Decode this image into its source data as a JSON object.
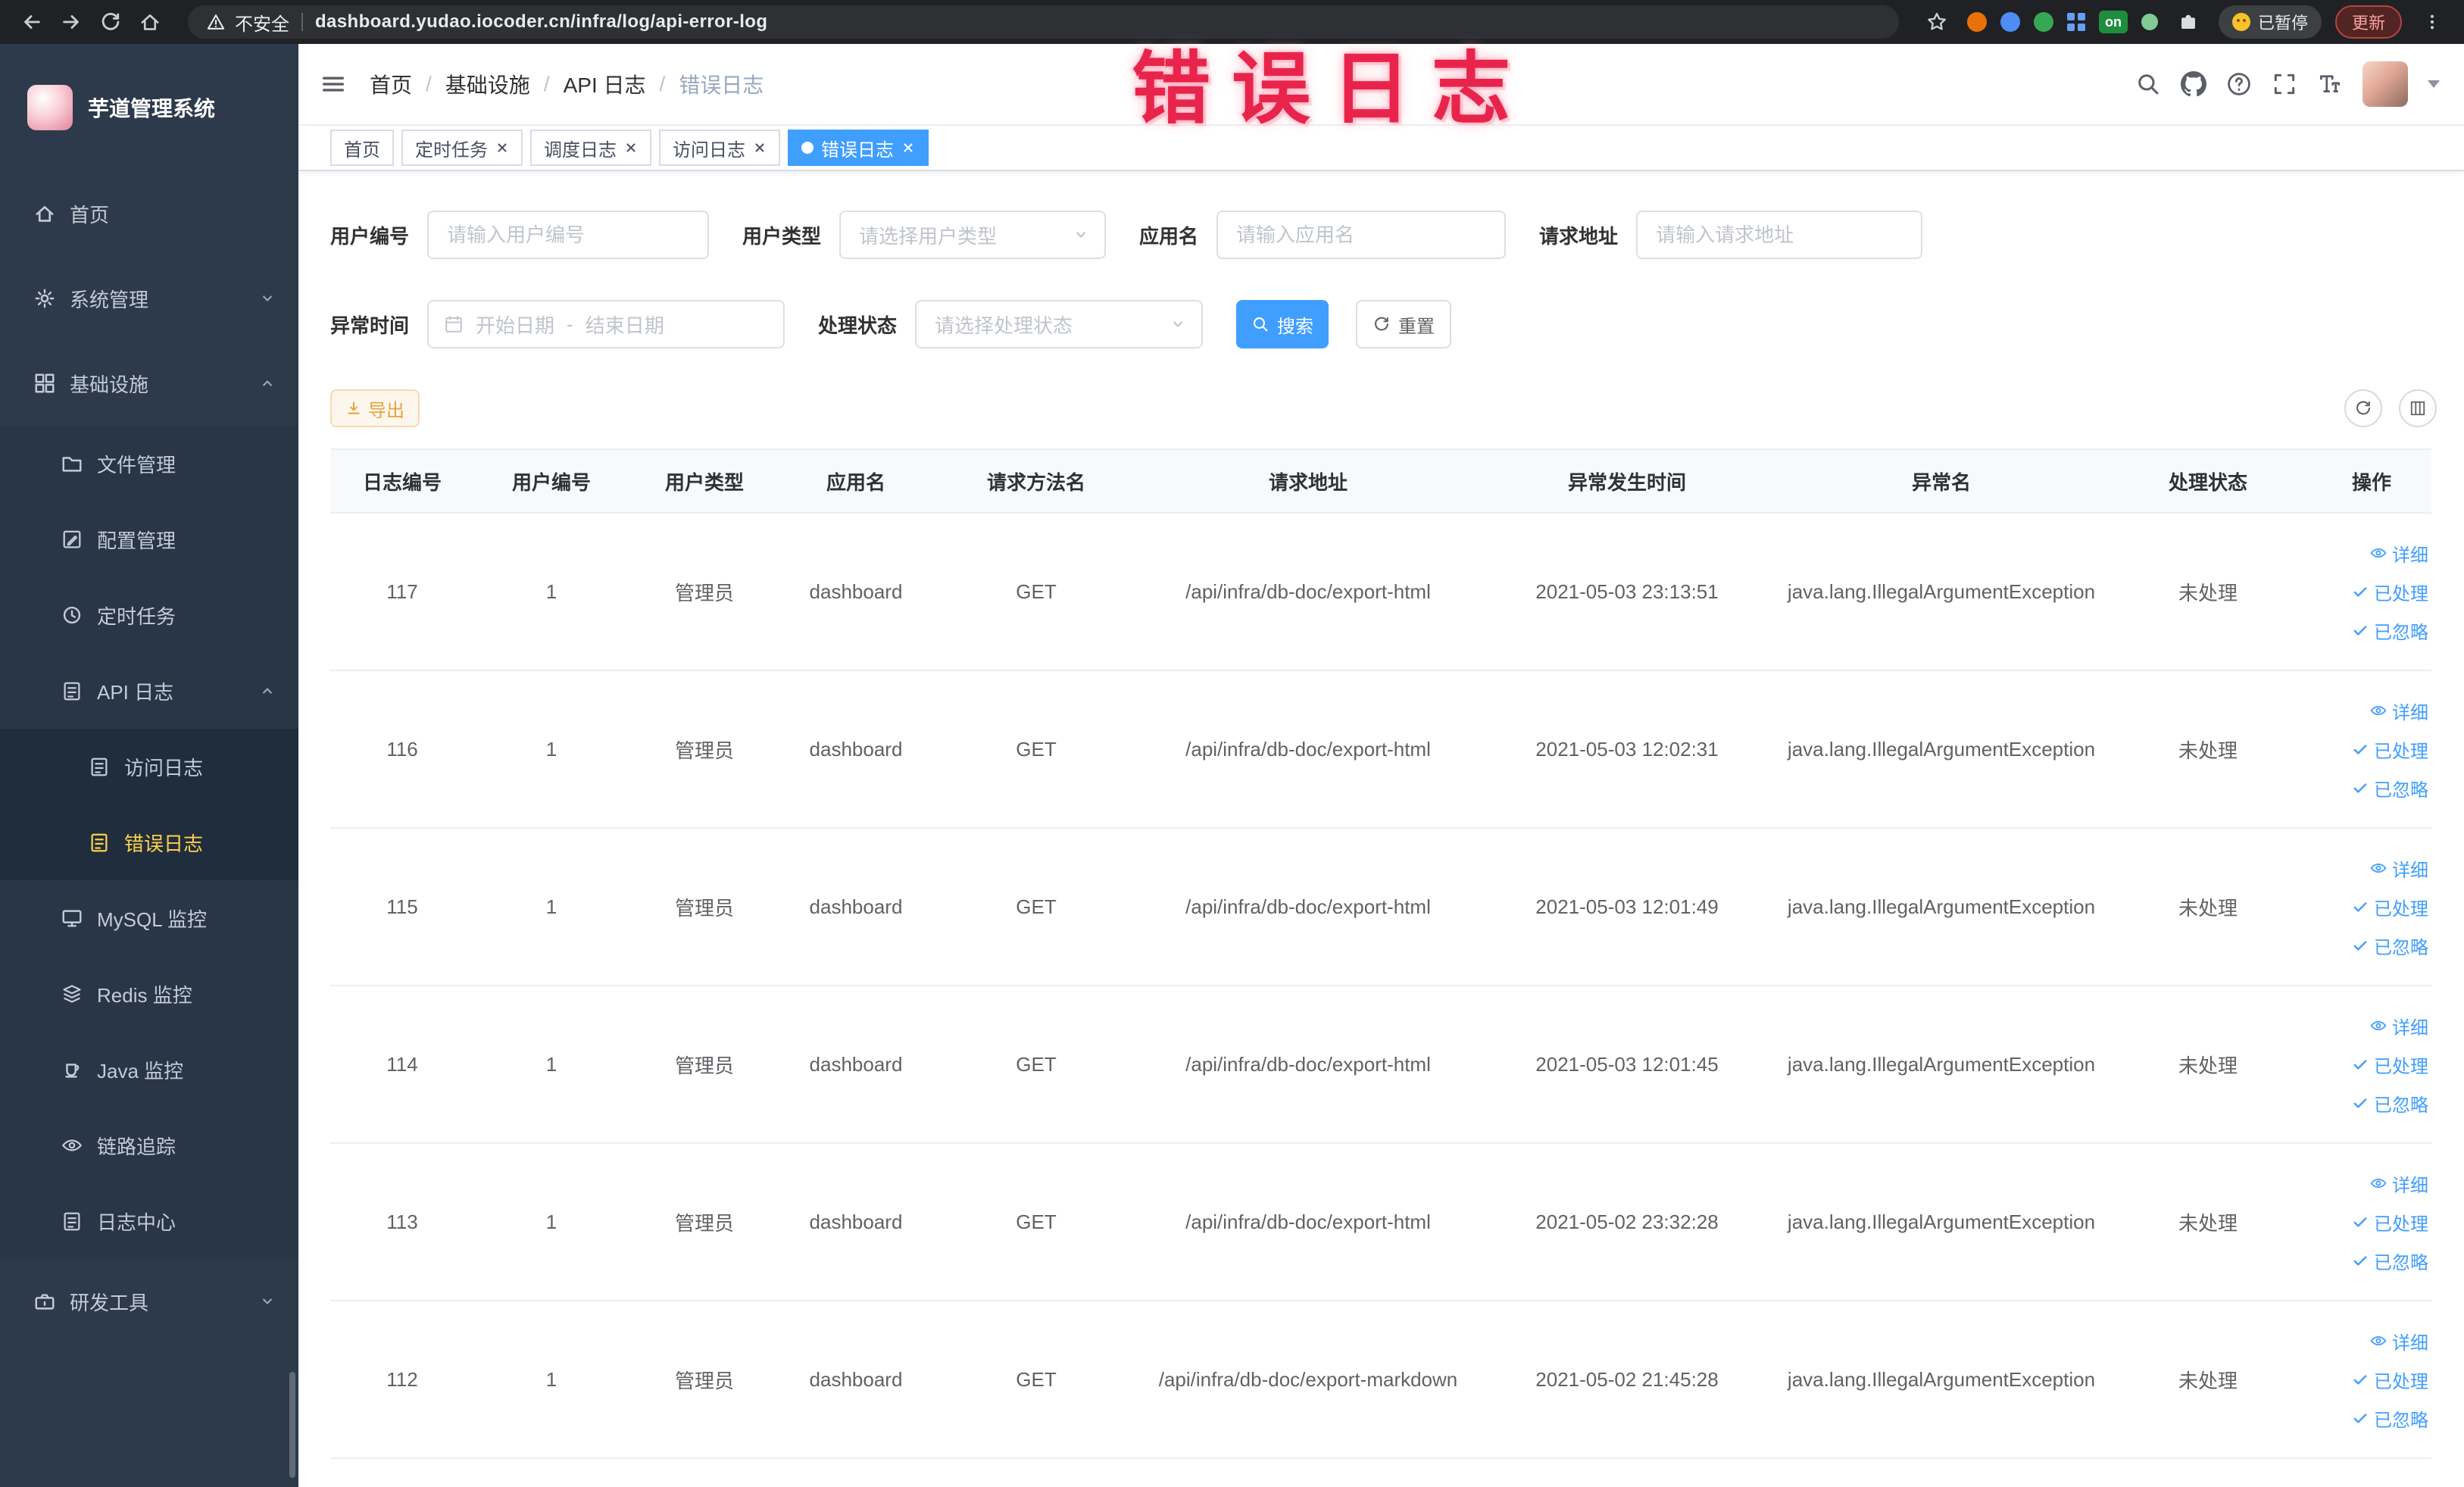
{
  "browser": {
    "security_label": "不安全",
    "url": "dashboard.yudao.iocoder.cn/infra/log/api-error-log",
    "extension_on_badge": "on",
    "paused_badge": "已暂停",
    "update_label": "更新"
  },
  "annotation": {
    "watermark": "错误日志"
  },
  "sidebar": {
    "logo_title": "芋道管理系统",
    "items": [
      {
        "label": "首页"
      },
      {
        "label": "系统管理"
      },
      {
        "label": "基础设施"
      },
      {
        "label": "文件管理"
      },
      {
        "label": "配置管理"
      },
      {
        "label": "定时任务"
      },
      {
        "label": "API 日志"
      },
      {
        "label": "访问日志"
      },
      {
        "label": "错误日志"
      },
      {
        "label": "MySQL 监控"
      },
      {
        "label": "Redis 监控"
      },
      {
        "label": "Java 监控"
      },
      {
        "label": "链路追踪"
      },
      {
        "label": "日志中心"
      },
      {
        "label": "研发工具"
      }
    ]
  },
  "header": {
    "breadcrumb": [
      "首页",
      "基础设施",
      "API 日志",
      "错误日志"
    ],
    "separator": "/"
  },
  "tabs": [
    {
      "label": "首页"
    },
    {
      "label": "定时任务"
    },
    {
      "label": "调度日志"
    },
    {
      "label": "访问日志"
    },
    {
      "label": "错误日志"
    }
  ],
  "filters": {
    "user_id_label": "用户编号",
    "user_id_placeholder": "请输入用户编号",
    "user_type_label": "用户类型",
    "user_type_placeholder": "请选择用户类型",
    "app_name_label": "应用名",
    "app_name_placeholder": "请输入应用名",
    "request_url_label": "请求地址",
    "request_url_placeholder": "请输入请求地址",
    "exception_time_label": "异常时间",
    "start_date_placeholder": "开始日期",
    "range_separator": "-",
    "end_date_placeholder": "结束日期",
    "process_status_label": "处理状态",
    "process_status_placeholder": "请选择处理状态",
    "search_button": "搜索",
    "reset_button": "重置"
  },
  "toolbar": {
    "export_button": "导出"
  },
  "table": {
    "columns": [
      "日志编号",
      "用户编号",
      "用户类型",
      "应用名",
      "请求方法名",
      "请求地址",
      "异常发生时间",
      "异常名",
      "处理状态",
      "操作"
    ],
    "actions": {
      "detail": "详细",
      "processed": "已处理",
      "ignored": "已忽略"
    },
    "rows": [
      {
        "log_id": "117",
        "user_id": "1",
        "user_type": "管理员",
        "app_name": "dashboard",
        "method": "GET",
        "url": "/api/infra/db-doc/export-html",
        "time": "2021-05-03 23:13:51",
        "exception": "java.lang.IllegalArgumentException",
        "status": "未处理"
      },
      {
        "log_id": "116",
        "user_id": "1",
        "user_type": "管理员",
        "app_name": "dashboard",
        "method": "GET",
        "url": "/api/infra/db-doc/export-html",
        "time": "2021-05-03 12:02:31",
        "exception": "java.lang.IllegalArgumentException",
        "status": "未处理"
      },
      {
        "log_id": "115",
        "user_id": "1",
        "user_type": "管理员",
        "app_name": "dashboard",
        "method": "GET",
        "url": "/api/infra/db-doc/export-html",
        "time": "2021-05-03 12:01:49",
        "exception": "java.lang.IllegalArgumentException",
        "status": "未处理"
      },
      {
        "log_id": "114",
        "user_id": "1",
        "user_type": "管理员",
        "app_name": "dashboard",
        "method": "GET",
        "url": "/api/infra/db-doc/export-html",
        "time": "2021-05-03 12:01:45",
        "exception": "java.lang.IllegalArgumentException",
        "status": "未处理"
      },
      {
        "log_id": "113",
        "user_id": "1",
        "user_type": "管理员",
        "app_name": "dashboard",
        "method": "GET",
        "url": "/api/infra/db-doc/export-html",
        "time": "2021-05-02 23:32:28",
        "exception": "java.lang.IllegalArgumentException",
        "status": "未处理"
      },
      {
        "log_id": "112",
        "user_id": "1",
        "user_type": "管理员",
        "app_name": "dashboard",
        "method": "GET",
        "url": "/api/infra/db-doc/export-markdown",
        "time": "2021-05-02 21:45:28",
        "exception": "java.lang.IllegalArgumentException",
        "status": "未处理"
      }
    ]
  }
}
